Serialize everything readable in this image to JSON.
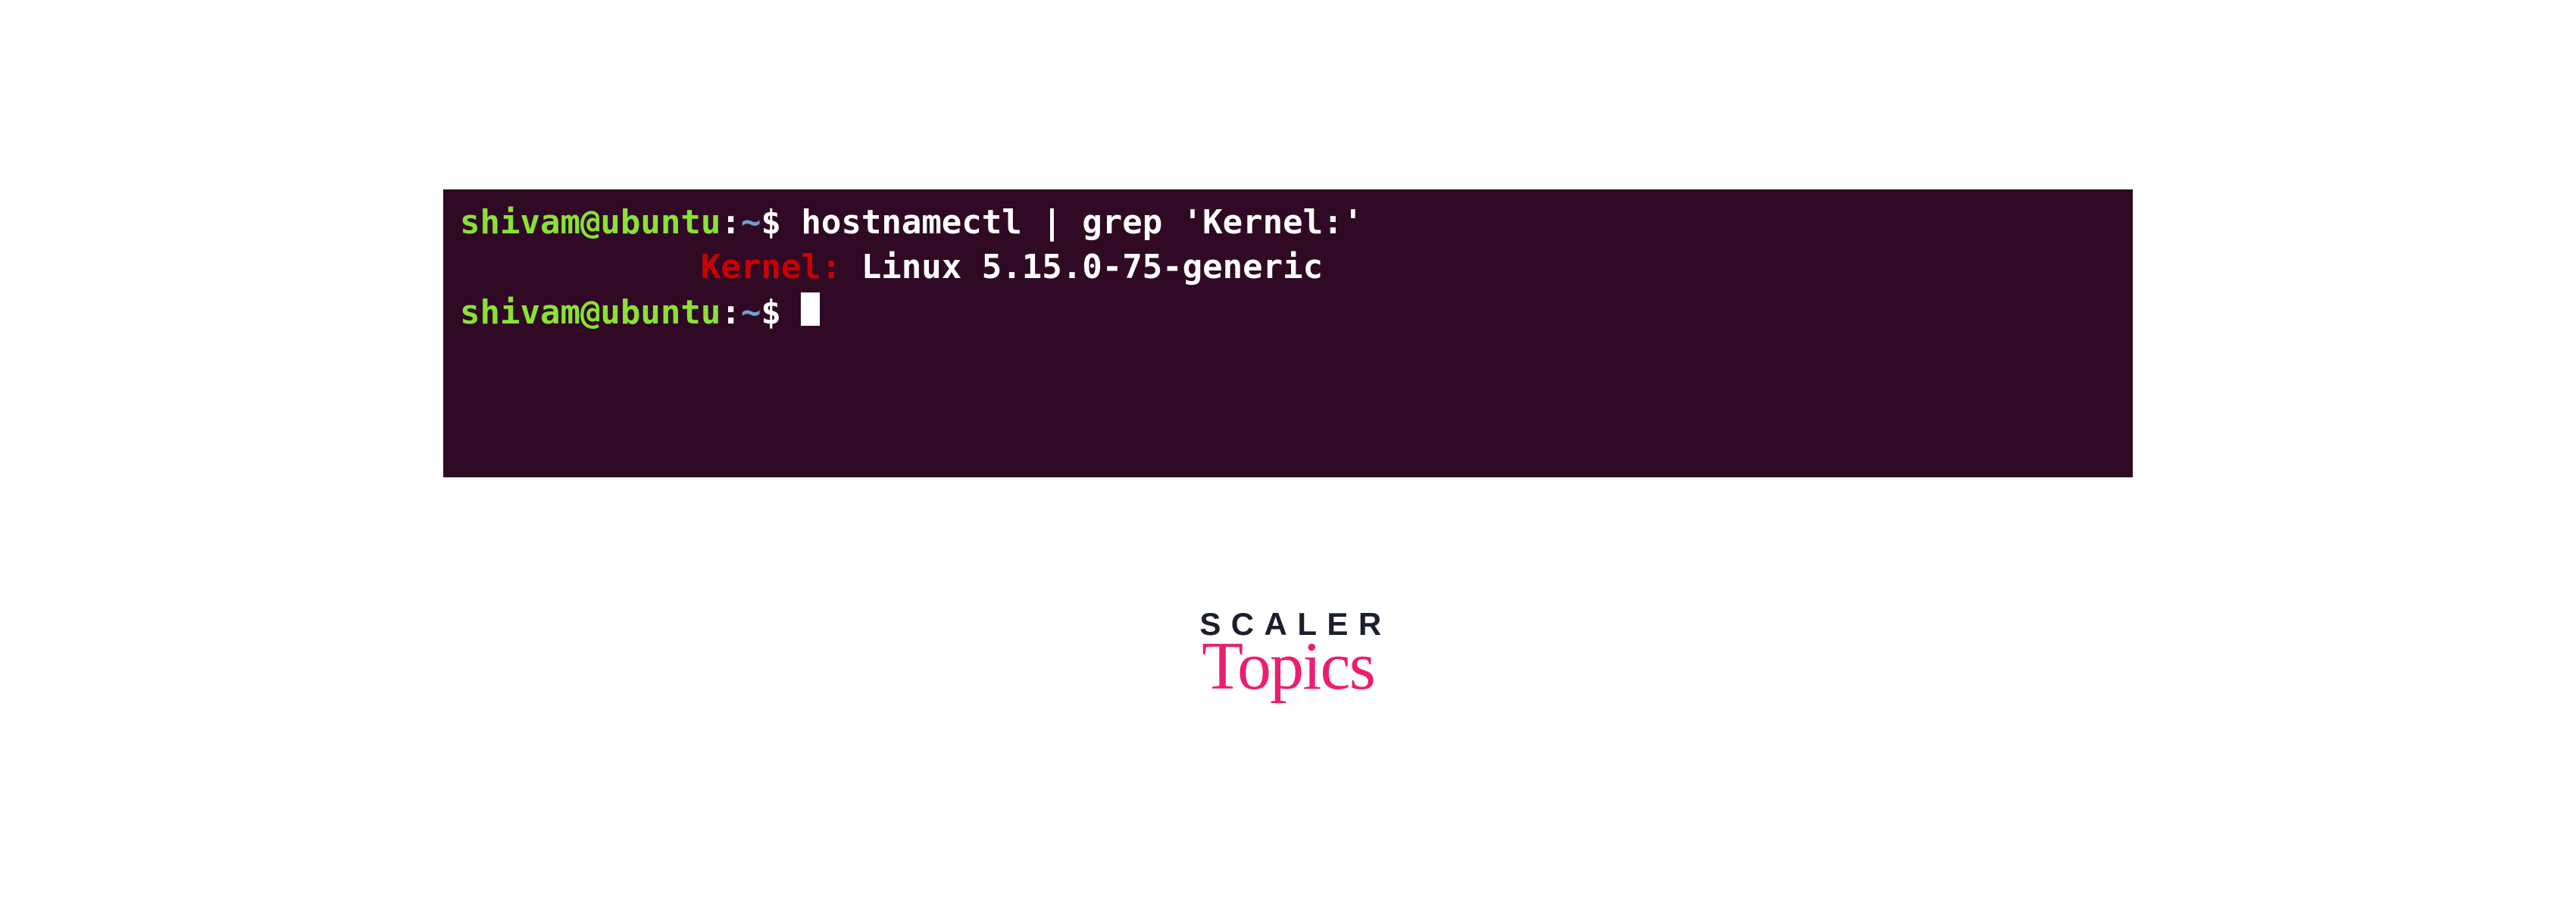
{
  "terminal": {
    "prompt": {
      "user_host": "shivam@ubuntu",
      "separator": ":",
      "path": "~",
      "symbol": "$"
    },
    "command": "hostnamectl | grep 'Kernel:'",
    "output": {
      "indent": "            ",
      "label": "Kernel:",
      "value": " Linux 5.15.0-75-generic"
    }
  },
  "logo": {
    "line1": "SCALER",
    "line2": "Topics"
  }
}
